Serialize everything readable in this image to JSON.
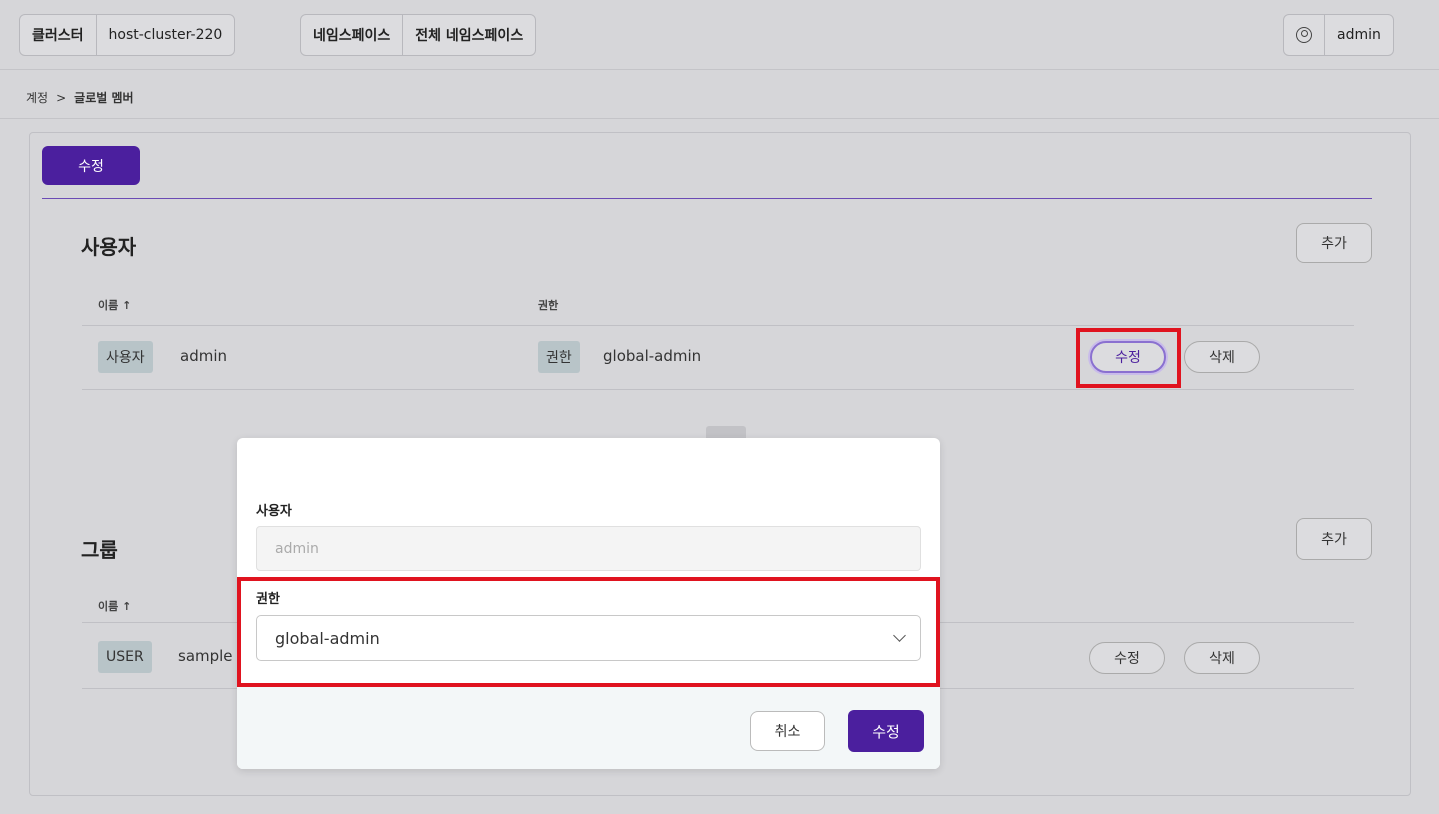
{
  "header": {
    "cluster_label": "클러스터",
    "cluster_value": "host-cluster-220",
    "namespace_label": "네임스페이스",
    "namespace_value": "전체 네임스페이스",
    "user_icon": "user-circle-icon",
    "username": "admin"
  },
  "breadcrumb": {
    "parent": "계정",
    "separator": ">",
    "current": "글로벌 멤버"
  },
  "toolbar": {
    "edit_label": "수정"
  },
  "users_section": {
    "title": "사용자",
    "add_label": "추가",
    "columns": {
      "name": "이름 ↑",
      "role": "권한"
    },
    "rows": [
      {
        "type_tag": "사용자",
        "name": "admin",
        "role_tag": "권한",
        "role": "global-admin",
        "edit_label": "수정",
        "delete_label": "삭제"
      }
    ]
  },
  "groups_section": {
    "title": "그룹",
    "add_label": "추가",
    "columns": {
      "name": "이름 ↑"
    },
    "rows": [
      {
        "type_tag": "USER",
        "name": "sample",
        "edit_label": "수정",
        "delete_label": "삭제"
      }
    ]
  },
  "modal": {
    "user_label": "사용자",
    "user_placeholder": "admin",
    "role_label": "권한",
    "role_value": "global-admin",
    "cancel_label": "취소",
    "confirm_label": "수정"
  },
  "colors": {
    "brand_purple": "#4b1f9e",
    "highlight_red": "#e0131f",
    "tag_bg": "#b8c4c8"
  }
}
